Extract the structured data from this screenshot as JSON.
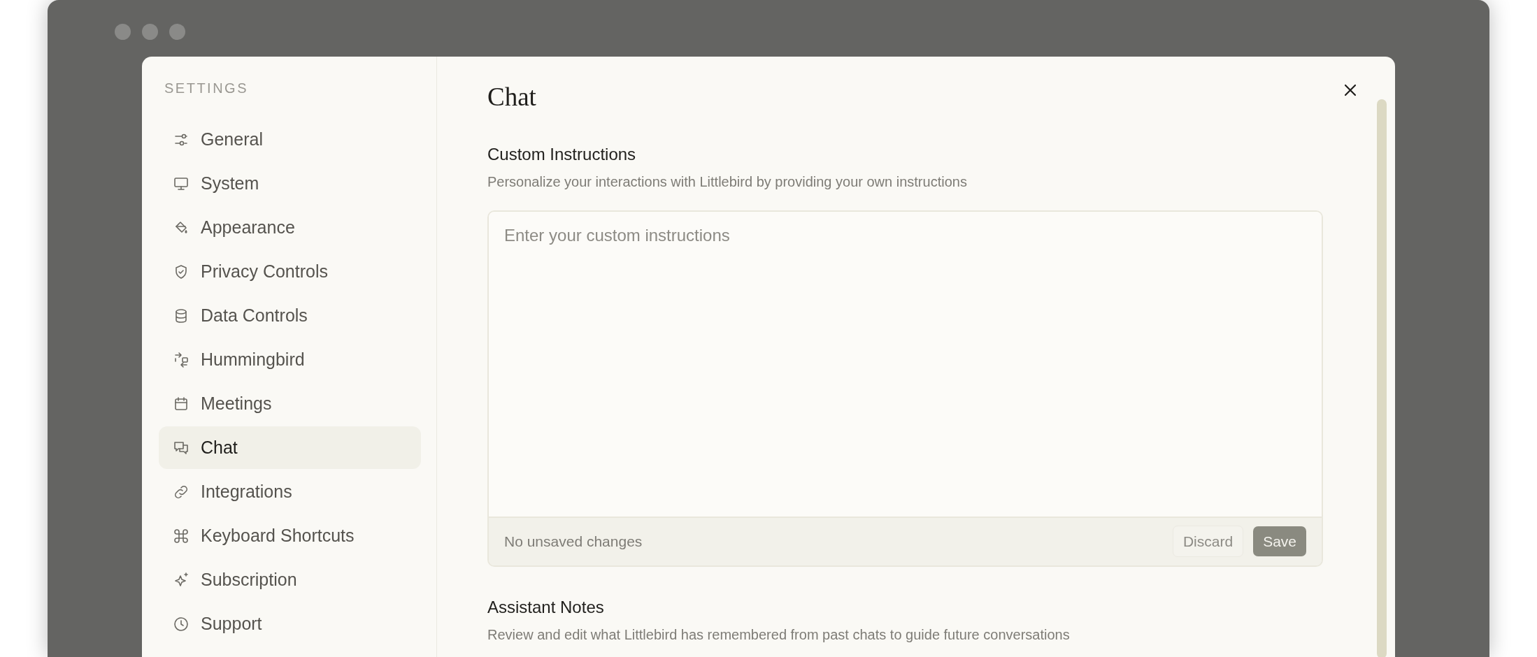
{
  "sidebar": {
    "heading": "SETTINGS",
    "items": [
      {
        "label": "General",
        "selected": false
      },
      {
        "label": "System",
        "selected": false
      },
      {
        "label": "Appearance",
        "selected": false
      },
      {
        "label": "Privacy Controls",
        "selected": false
      },
      {
        "label": "Data Controls",
        "selected": false
      },
      {
        "label": "Hummingbird",
        "selected": false
      },
      {
        "label": "Meetings",
        "selected": false
      },
      {
        "label": "Chat",
        "selected": true
      },
      {
        "label": "Integrations",
        "selected": false
      },
      {
        "label": "Keyboard Shortcuts",
        "selected": false
      },
      {
        "label": "Subscription",
        "selected": false
      },
      {
        "label": "Support",
        "selected": false
      }
    ]
  },
  "page": {
    "title": "Chat",
    "custom_instructions": {
      "title": "Custom Instructions",
      "description": "Personalize your interactions with Littlebird by providing your own instructions",
      "placeholder": "Enter your custom instructions",
      "status": "No unsaved changes",
      "buttons": [
        "Discard",
        "Save"
      ]
    },
    "assistant_notes": {
      "title": "Assistant Notes",
      "description": "Review and edit what Littlebird has remembered from past chats to guide future conversations"
    }
  }
}
